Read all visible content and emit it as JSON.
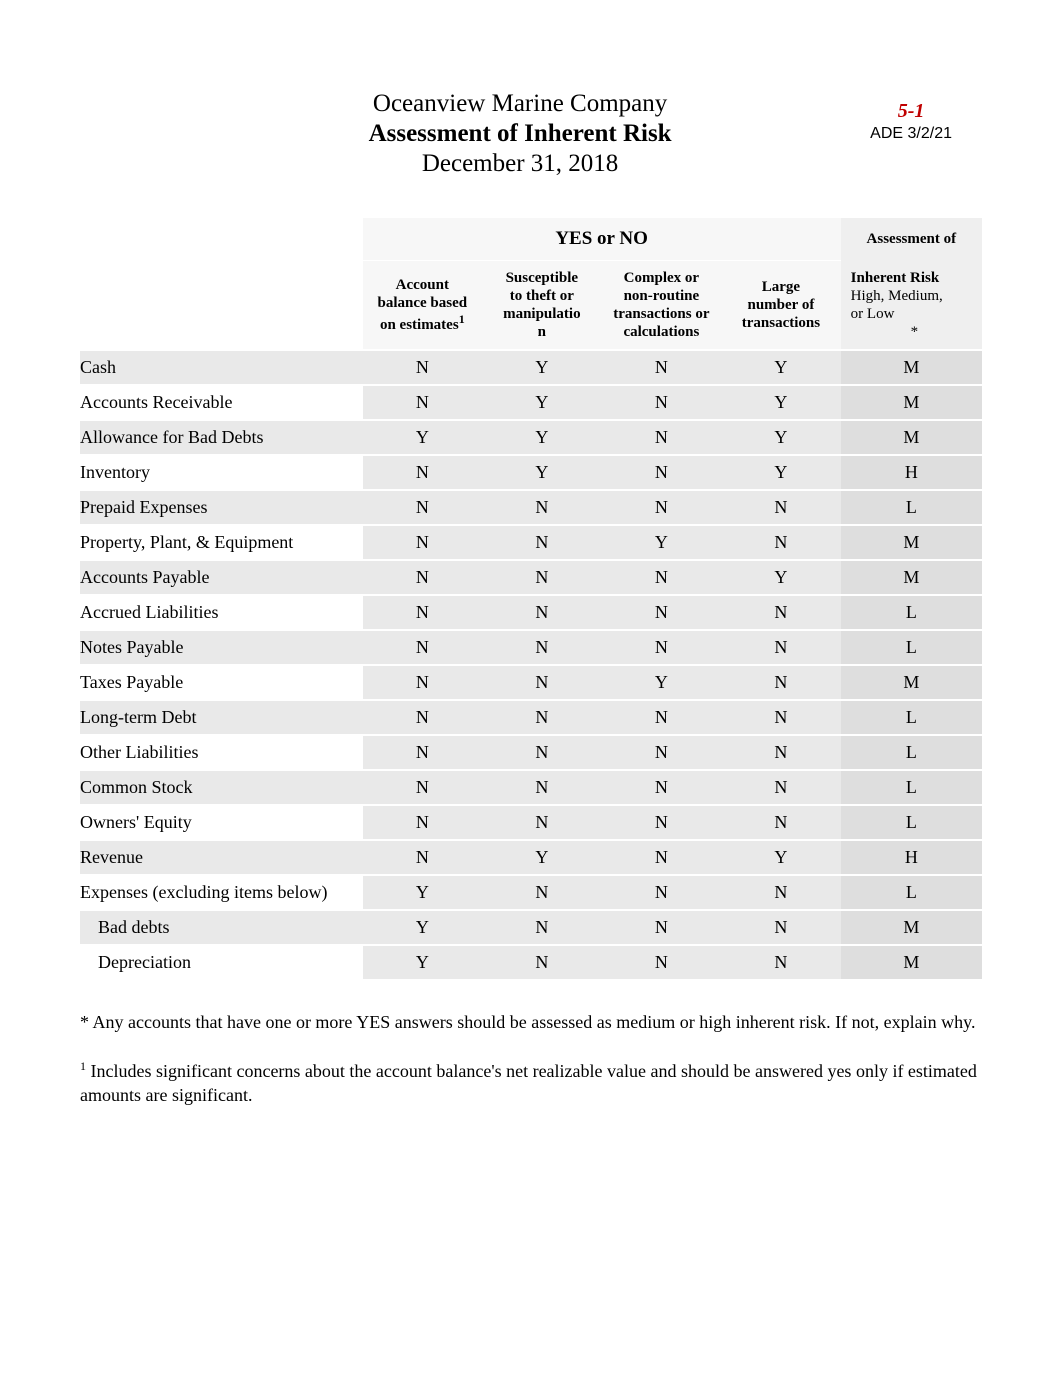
{
  "header": {
    "company": "Oceanview Marine Company",
    "title": "Assessment of Inherent Risk",
    "date": "December 31, 2018",
    "ref_num": "5-1",
    "ref_date": "ADE 3/2/21"
  },
  "table": {
    "group_header": "YES or NO",
    "assessment_header": "Assessment of",
    "columns": {
      "c1_line1": "Account",
      "c1_line2": "balance based",
      "c1_line3": "on estimates",
      "c1_sup": "1",
      "c2_line1": "Susceptible",
      "c2_line2": "to theft or",
      "c2_line3": "manipulatio",
      "c2_line4": "n",
      "c3_line1": "Complex or",
      "c3_line2": "non-routine",
      "c3_line3": "transactions or",
      "c3_line4": "calculations",
      "c4_line1": "Large",
      "c4_line2": "number of",
      "c4_line3": "transactions",
      "c5_line1": "Inherent Risk",
      "c5_line2": "High, Medium,",
      "c5_line3": "or Low",
      "c5_line4": "*"
    },
    "rows": [
      {
        "label": "Cash",
        "c1": "N",
        "c2": "Y",
        "c3": "N",
        "c4": "Y",
        "risk": "M",
        "indent": false
      },
      {
        "label": "Accounts Receivable",
        "c1": "N",
        "c2": "Y",
        "c3": "N",
        "c4": "Y",
        "risk": "M",
        "indent": false
      },
      {
        "label": "Allowance for Bad Debts",
        "c1": "Y",
        "c2": "Y",
        "c3": "N",
        "c4": "Y",
        "risk": "M",
        "indent": false
      },
      {
        "label": "Inventory",
        "c1": "N",
        "c2": "Y",
        "c3": "N",
        "c4": "Y",
        "risk": "H",
        "indent": false
      },
      {
        "label": "Prepaid Expenses",
        "c1": "N",
        "c2": "N",
        "c3": "N",
        "c4": "N",
        "risk": "L",
        "indent": false
      },
      {
        "label": "Property, Plant, & Equipment",
        "c1": "N",
        "c2": "N",
        "c3": "Y",
        "c4": "N",
        "risk": "M",
        "indent": false
      },
      {
        "label": "Accounts Payable",
        "c1": "N",
        "c2": "N",
        "c3": "N",
        "c4": "Y",
        "risk": "M",
        "indent": false
      },
      {
        "label": "Accrued Liabilities",
        "c1": "N",
        "c2": "N",
        "c3": "N",
        "c4": "N",
        "risk": "L",
        "indent": false
      },
      {
        "label": "Notes Payable",
        "c1": "N",
        "c2": "N",
        "c3": "N",
        "c4": "N",
        "risk": "L",
        "indent": false
      },
      {
        "label": "Taxes Payable",
        "c1": "N",
        "c2": "N",
        "c3": "Y",
        "c4": "N",
        "risk": "M",
        "indent": false
      },
      {
        "label": "Long-term Debt",
        "c1": "N",
        "c2": "N",
        "c3": "N",
        "c4": "N",
        "risk": "L",
        "indent": false
      },
      {
        "label": "Other Liabilities",
        "c1": "N",
        "c2": "N",
        "c3": "N",
        "c4": "N",
        "risk": "L",
        "indent": false
      },
      {
        "label": "Common Stock",
        "c1": "N",
        "c2": "N",
        "c3": "N",
        "c4": "N",
        "risk": "L",
        "indent": false
      },
      {
        "label": "Owners' Equity",
        "c1": "N",
        "c2": "N",
        "c3": "N",
        "c4": "N",
        "risk": "L",
        "indent": false
      },
      {
        "label": "Revenue",
        "c1": "N",
        "c2": "Y",
        "c3": "N",
        "c4": "Y",
        "risk": "H",
        "indent": false
      },
      {
        "label": "Expenses (excluding items below)",
        "c1": "Y",
        "c2": "N",
        "c3": "N",
        "c4": "N",
        "risk": "L",
        "indent": false
      },
      {
        "label": "Bad debts",
        "c1": "Y",
        "c2": "N",
        "c3": "N",
        "c4": "N",
        "risk": "M",
        "indent": true
      },
      {
        "label": "Depreciation",
        "c1": "Y",
        "c2": "N",
        "c3": "N",
        "c4": "N",
        "risk": "M",
        "indent": true
      }
    ]
  },
  "footnotes": {
    "note1": "* Any accounts that have one or more YES answers should be assessed as medium or high inherent risk. If not, explain why.",
    "note2_sup": "1",
    "note2": " Includes significant concerns about the account balance's net realizable value and should be answered yes only if estimated amounts are significant."
  }
}
